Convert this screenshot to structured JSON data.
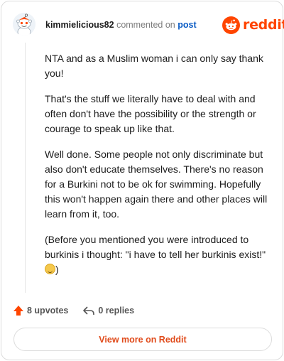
{
  "header": {
    "username": "kimmielicious82",
    "commented_on": "commented on",
    "post_link": "post",
    "brand": "reddit"
  },
  "comment": {
    "paragraphs": [
      "NTA and as a Muslim woman i can only say thank you!",
      "That's the stuff we literally have to deal with and often don't have the possibility or the strength or courage to speak up like that.",
      "Well done. Some people not only discriminate but also don't educate themselves. There's no reason for a Burkini not to be ok for swimming. Hopefully this won't happen again there and other places will learn from it, too.",
      "(Before you mentioned you were introduced to burkinis i thought: \"i have to tell her burkinis exist!\""
    ],
    "closing": ")",
    "emoji": "grinning-sweat-emoji"
  },
  "actions": {
    "upvotes": "8 upvotes",
    "replies": "0 replies"
  },
  "footer": {
    "view_more": "View more on Reddit"
  },
  "colors": {
    "brand": "#ff4500",
    "link": "#0a5bc4",
    "upvote": "#ff4500",
    "view_more_text": "#e04a1a"
  },
  "icons": {
    "avatar": "snoo-avatar-icon",
    "logo": "reddit-logo-icon",
    "upvote": "upvote-arrow-icon",
    "reply": "reply-arrow-icon"
  }
}
